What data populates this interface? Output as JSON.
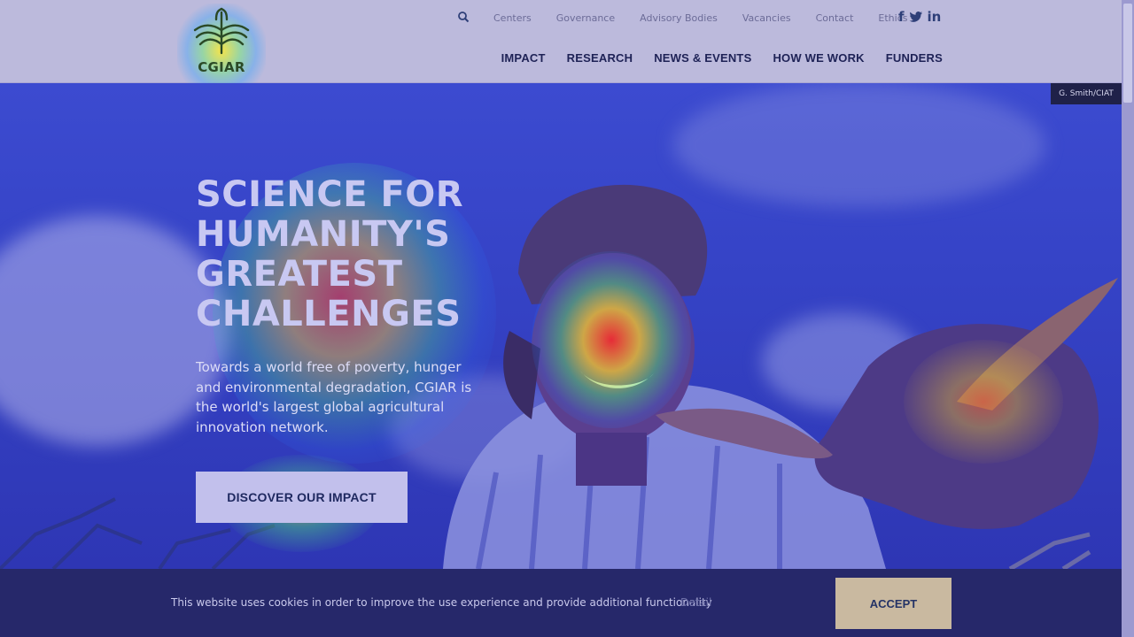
{
  "brand": {
    "logo_text": "CGIAR"
  },
  "utility_nav": [
    "Centers",
    "Governance",
    "Advisory Bodies",
    "Vacancies",
    "Contact",
    "Ethics"
  ],
  "social": {
    "facebook": "f",
    "twitter": "t",
    "linkedin": "in"
  },
  "main_nav": [
    "IMPACT",
    "RESEARCH",
    "NEWS & EVENTS",
    "HOW WE WORK",
    "FUNDERS"
  ],
  "hero": {
    "photo_credit": "G. Smith/CIAT",
    "title_lines": [
      "SCIENCE FOR",
      "HUMANITY'S",
      "GREATEST",
      "CHALLENGES"
    ],
    "text": "Towards a world free of poverty, hunger and environmental degradation, CGIAR is the world's largest global agricultural innovation network.",
    "button_label": "DISCOVER OUR IMPACT"
  },
  "cookie": {
    "text": "This website uses cookies in order to improve the use experience and provide additional functionality",
    "detail_label": "Detail",
    "accept_label": "ACCEPT"
  },
  "colors": {
    "header_bg": "#bcbadc",
    "nav_text": "#1e2256",
    "cookie_bg": "#26286a",
    "accept_bg": "#c9b9a0"
  }
}
